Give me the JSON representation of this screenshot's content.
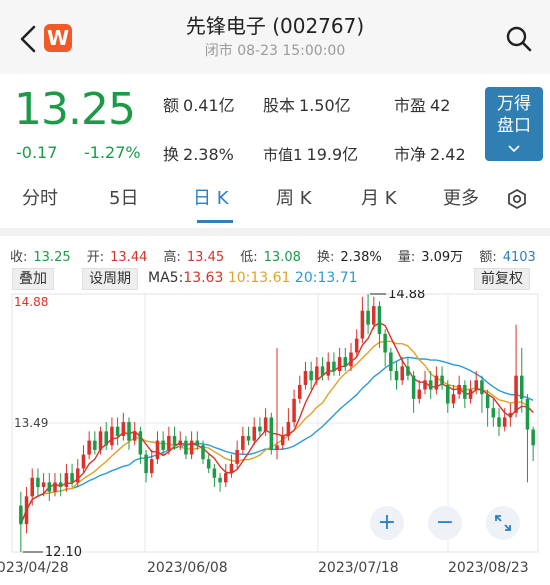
{
  "header": {
    "title": "先锋电子 (002767)",
    "status_line": "闭市 08-23 15:00:00",
    "app_icon_letter": "W"
  },
  "quote": {
    "price": "13.25",
    "change": "-0.17",
    "change_pct": "-1.27%",
    "amount_label": "额",
    "amount_value": "0.41亿",
    "turnover_label": "换",
    "turnover_value": "2.38%",
    "share_cap_label": "股本",
    "share_cap_value": "1.50亿",
    "mkt_cap_label": "市值1",
    "mkt_cap_value": "19.9亿",
    "pe_label": "市盈",
    "pe_value": "42",
    "pb_label": "市净",
    "pb_value": "2.42",
    "wande_button": "万得\n盘口"
  },
  "tabs": {
    "fenshi": "分时",
    "five_day": "5日",
    "day_k": "日 K",
    "week_k": "周 K",
    "month_k": "月 K",
    "more": "更多"
  },
  "info_bar": {
    "close_label": "收:",
    "close_value": "13.25",
    "open_label": "开:",
    "open_value": "13.44",
    "high_label": "高:",
    "high_value": "13.45",
    "low_label": "低:",
    "low_value": "13.08",
    "turnover_label": "换:",
    "turnover_value": "2.38%",
    "volume_label": "量:",
    "volume_value": "3.09万",
    "amount_label": "额:",
    "amount_value": "4103"
  },
  "toolbar": {
    "overlay": "叠加",
    "set_period": "设周期",
    "ma5_label": "MA5:",
    "ma5_value": "13.63",
    "ma10_label": "10:",
    "ma10_value": "13.61",
    "ma20_label": "20:",
    "ma20_value": "13.71",
    "adjust": "前复权"
  },
  "chart_data": {
    "type": "candlestick",
    "y_max_label": "14.88",
    "y_mid_label": "13.49",
    "high_marker": "14.88",
    "low_marker": "12.10",
    "ylim": [
      12.1,
      14.88
    ],
    "x_labels": [
      "2023/04/28",
      "2023/06/08",
      "2023/07/18",
      "2023/08/23"
    ],
    "candles": [
      [
        12.6,
        12.4,
        12.75,
        12.1
      ],
      [
        12.4,
        12.7,
        12.8,
        12.3
      ],
      [
        12.7,
        12.9,
        13.0,
        12.6
      ],
      [
        12.9,
        12.8,
        13.0,
        12.7
      ],
      [
        12.8,
        12.85,
        12.95,
        12.7
      ],
      [
        12.85,
        12.75,
        12.95,
        12.65
      ],
      [
        12.75,
        12.85,
        12.95,
        12.7
      ],
      [
        12.85,
        12.8,
        12.95,
        12.7
      ],
      [
        12.8,
        12.95,
        13.05,
        12.75
      ],
      [
        12.95,
        12.85,
        13.05,
        12.8
      ],
      [
        12.85,
        13.0,
        13.1,
        12.8
      ],
      [
        13.0,
        13.15,
        13.25,
        12.95
      ],
      [
        13.15,
        13.3,
        13.4,
        13.1
      ],
      [
        13.3,
        13.2,
        13.4,
        13.15
      ],
      [
        13.2,
        13.4,
        13.45,
        13.15
      ],
      [
        13.4,
        13.25,
        13.5,
        13.2
      ],
      [
        13.25,
        13.45,
        13.55,
        13.2
      ],
      [
        13.45,
        13.35,
        13.55,
        13.25
      ],
      [
        13.35,
        13.5,
        13.6,
        13.3
      ],
      [
        13.5,
        13.3,
        13.55,
        13.2
      ],
      [
        13.3,
        13.4,
        13.5,
        13.25
      ],
      [
        13.4,
        13.15,
        13.45,
        13.05
      ],
      [
        13.15,
        12.95,
        13.2,
        12.85
      ],
      [
        12.95,
        13.1,
        13.2,
        12.9
      ],
      [
        13.1,
        13.3,
        13.4,
        13.05
      ],
      [
        13.3,
        13.2,
        13.4,
        13.15
      ],
      [
        13.2,
        13.35,
        13.45,
        13.15
      ],
      [
        13.35,
        13.25,
        13.45,
        13.2
      ],
      [
        13.25,
        13.3,
        13.4,
        13.2
      ],
      [
        13.3,
        13.15,
        13.35,
        13.1
      ],
      [
        13.15,
        13.3,
        13.4,
        13.1
      ],
      [
        13.3,
        13.25,
        13.4,
        13.2
      ],
      [
        13.25,
        13.1,
        13.3,
        13.05
      ],
      [
        13.1,
        13.0,
        13.15,
        12.95
      ],
      [
        13.0,
        12.9,
        13.05,
        12.8
      ],
      [
        12.9,
        12.85,
        12.95,
        12.75
      ],
      [
        12.85,
        12.95,
        13.05,
        12.8
      ],
      [
        12.95,
        13.05,
        13.15,
        12.9
      ],
      [
        13.05,
        13.2,
        13.3,
        13.0
      ],
      [
        13.2,
        13.35,
        13.45,
        13.15
      ],
      [
        13.35,
        13.3,
        13.45,
        13.25
      ],
      [
        13.3,
        13.45,
        13.55,
        13.25
      ],
      [
        13.45,
        13.4,
        13.55,
        13.35
      ],
      [
        13.4,
        13.55,
        13.65,
        13.35
      ],
      [
        13.55,
        13.2,
        13.6,
        13.15
      ],
      [
        13.2,
        13.25,
        14.3,
        13.1
      ],
      [
        13.25,
        13.35,
        13.45,
        13.2
      ],
      [
        13.35,
        13.5,
        13.65,
        13.3
      ],
      [
        13.5,
        13.75,
        13.85,
        13.45
      ],
      [
        13.75,
        13.9,
        14.0,
        13.7
      ],
      [
        13.9,
        14.05,
        14.15,
        13.85
      ],
      [
        14.05,
        13.95,
        14.15,
        13.85
      ],
      [
        13.95,
        14.1,
        14.2,
        13.9
      ],
      [
        14.1,
        14.0,
        14.2,
        13.95
      ],
      [
        14.0,
        14.15,
        14.25,
        13.95
      ],
      [
        14.15,
        14.05,
        14.25,
        14.0
      ],
      [
        14.05,
        14.2,
        14.3,
        14.0
      ],
      [
        14.2,
        14.1,
        14.3,
        14.05
      ],
      [
        14.1,
        14.25,
        14.35,
        14.05
      ],
      [
        14.25,
        14.4,
        14.5,
        14.2
      ],
      [
        14.4,
        14.7,
        14.85,
        14.35
      ],
      [
        14.7,
        14.55,
        14.88,
        14.45
      ],
      [
        14.55,
        14.75,
        14.85,
        14.5
      ],
      [
        14.75,
        14.45,
        14.8,
        14.3
      ],
      [
        14.45,
        14.25,
        14.5,
        14.1
      ],
      [
        14.25,
        14.05,
        14.3,
        13.95
      ],
      [
        14.05,
        13.95,
        14.15,
        13.85
      ],
      [
        13.95,
        14.1,
        14.2,
        13.9
      ],
      [
        14.1,
        14.0,
        14.2,
        13.95
      ],
      [
        14.0,
        13.75,
        14.05,
        13.6
      ],
      [
        13.75,
        13.85,
        13.95,
        13.7
      ],
      [
        13.85,
        13.95,
        14.05,
        13.8
      ],
      [
        13.95,
        13.85,
        14.05,
        13.75
      ],
      [
        13.85,
        14.0,
        14.1,
        13.8
      ],
      [
        14.0,
        13.9,
        14.1,
        13.85
      ],
      [
        13.9,
        13.7,
        13.95,
        13.6
      ],
      [
        13.7,
        13.8,
        13.9,
        13.65
      ],
      [
        13.8,
        13.9,
        14.0,
        13.75
      ],
      [
        13.9,
        13.75,
        13.95,
        13.65
      ],
      [
        13.75,
        13.85,
        13.95,
        13.7
      ],
      [
        13.85,
        13.95,
        14.05,
        13.8
      ],
      [
        13.95,
        13.8,
        14.0,
        13.6
      ],
      [
        13.8,
        13.65,
        13.85,
        13.45
      ],
      [
        13.65,
        13.55,
        13.75,
        13.45
      ],
      [
        13.55,
        13.45,
        13.65,
        13.35
      ],
      [
        13.45,
        13.55,
        13.65,
        13.4
      ],
      [
        13.55,
        13.6,
        13.7,
        13.45
      ],
      [
        13.6,
        14.0,
        14.55,
        13.55
      ],
      [
        14.0,
        13.75,
        14.3,
        13.6
      ],
      [
        13.75,
        13.42,
        13.8,
        12.85
      ],
      [
        13.42,
        13.25,
        13.45,
        13.08
      ]
    ]
  }
}
